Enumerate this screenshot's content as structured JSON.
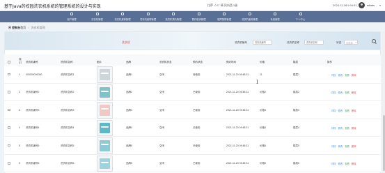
{
  "app": {
    "title": "基于Java的校园洗衣机系统的管理系统的设计与实现",
    "weather": "拉萨 -0.1° 晴 风向西 1级",
    "datetime": "2024-11-28 9:04:51",
    "username": "admin",
    "caret": "▾"
  },
  "nav": [
    {
      "label": "用户管理",
      "active": false
    },
    {
      "label": "洗衣机管理",
      "active": false
    },
    {
      "label": "洗衣机报修管理",
      "active": false
    },
    {
      "label": "洗衣机维修管理",
      "active": false
    },
    {
      "label": "洗衣机预约管理",
      "active": false
    },
    {
      "label": "预约取消管理",
      "active": false
    },
    {
      "label": "故障报修管理",
      "active": false
    },
    {
      "label": "洗衣机使用管理",
      "active": false
    },
    {
      "label": "系统管理",
      "active": false
    },
    {
      "label": "个人中心",
      "active": false
    }
  ],
  "breadcrumb": {
    "home": "首页",
    "home_prefix": "▣ 控制台",
    "current": "洗衣机管理"
  },
  "filter": {
    "hint": "洗衣机",
    "label_number": "洗衣机编号",
    "placeholder_number": "洗衣机编号",
    "label_name": "洗衣机名称",
    "placeholder_name": "洗衣机名称",
    "label_status": "状态",
    "select_status": "请选择"
  },
  "table": {
    "headers": [
      "索引",
      "洗衣机编号",
      "洗衣机名称",
      "图片",
      "品牌",
      "洗衣机状态",
      "预约状态",
      "预约时间",
      "价格",
      "楼层",
      "操作"
    ],
    "actions": [
      "详情",
      "修改",
      "查看",
      "删除"
    ],
    "rows": [
      {
        "index": "1",
        "number": "000000000000",
        "name": "洗衣机名称1",
        "brand": "品牌1",
        "status": "空闲",
        "booking": "待使用",
        "time": "2021-11-20 09:48:31",
        "price": "11",
        "floor": "楼层1",
        "img_color": "#cfd6d9"
      },
      {
        "index": "2",
        "number": "洗衣机编号2",
        "name": "洗衣机名称2",
        "brand": "品牌2",
        "status": "空闲",
        "booking": "已使用",
        "time": "2021-11-20 09:48:31",
        "price": "价格2",
        "floor": "楼层2",
        "img_color": "#7fc3c9"
      },
      {
        "index": "3",
        "number": "洗衣机编号3",
        "name": "洗衣机名称3",
        "brand": "品牌3",
        "status": "空闲",
        "booking": "已使用",
        "time": "2021-11-20 09:48:31",
        "price": "价格3",
        "floor": "楼层3",
        "img_color": "#f2c9c2"
      },
      {
        "index": "4",
        "number": "洗衣机编号4",
        "name": "洗衣机名称4",
        "brand": "品牌4",
        "status": "空闲",
        "booking": "已使用",
        "time": "2021-11-20 09:48:31",
        "price": "价格4",
        "floor": "楼层4",
        "img_color": "#5fb8c9"
      },
      {
        "index": "5",
        "number": "洗衣机编号5",
        "name": "洗衣机名称5",
        "brand": "品牌5",
        "status": "空闲",
        "booking": "已使用",
        "time": "2021-11-20 09:48:31",
        "price": "价格5",
        "floor": "楼层5",
        "img_color": "#8ccad6"
      },
      {
        "index": "6",
        "number": "洗衣机编号6",
        "name": "洗衣机名称6",
        "brand": "品牌6",
        "status": "空闲",
        "booking": "已使用",
        "time": "2021-11-20 09:48:31",
        "price": "价格6",
        "floor": "楼层6",
        "img_color": "#9cd3df"
      }
    ]
  },
  "icons": [
    "search-icon",
    "avatar",
    "nav-icon",
    "checkbox"
  ],
  "colors": {
    "nav_bg": "#5a6f95",
    "link": "#3a8ee6",
    "danger": "#e05050",
    "success": "#45a86a"
  }
}
